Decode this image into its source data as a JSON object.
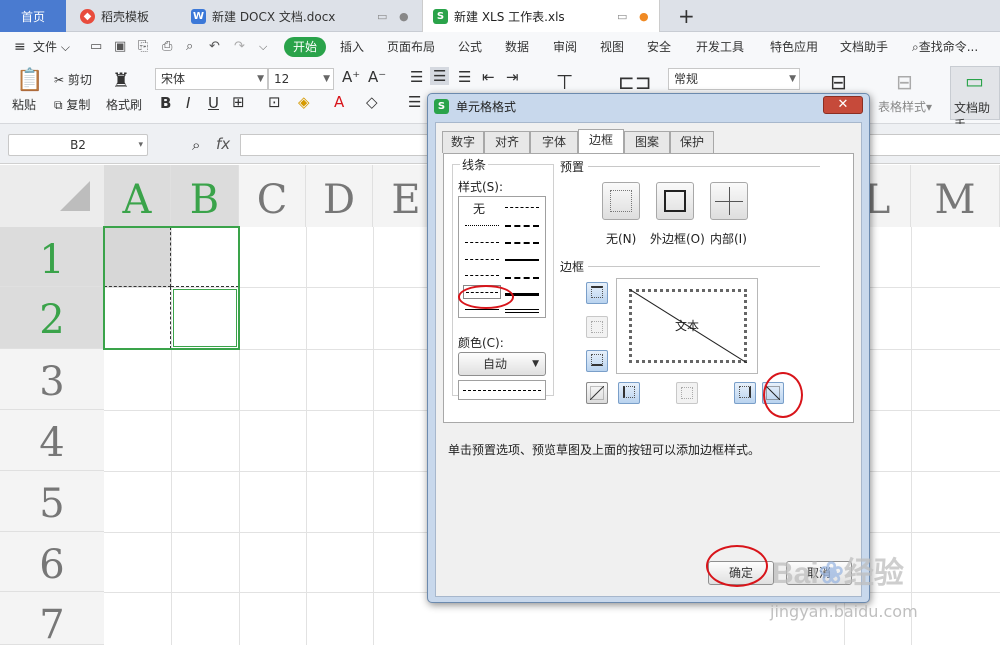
{
  "tabs": {
    "home": "首页",
    "template": "稻壳模板",
    "docx": "新建 DOCX 文档.docx",
    "xls": "新建 XLS 工作表.xls",
    "add": "+"
  },
  "menu": {
    "file": "文件",
    "start": "开始",
    "items": [
      "插入",
      "页面布局",
      "公式",
      "数据",
      "审阅",
      "视图",
      "安全",
      "开发工具",
      "特色应用",
      "文档助手"
    ],
    "search": "查找命令..."
  },
  "ribbon": {
    "paste": "粘贴",
    "cut": "剪切",
    "copy": "复制",
    "format_painter": "格式刷",
    "font": "宋体",
    "size": "12",
    "bold": "B",
    "italic": "I",
    "underline": "U",
    "number_format": "常规",
    "table_style": "表格样式",
    "doc_helper": "文档助手"
  },
  "formula": {
    "cell_ref": "B2",
    "fx": "fx"
  },
  "grid": {
    "columns": [
      "A",
      "B",
      "C",
      "D",
      "E",
      "L",
      "M"
    ],
    "rows": [
      "1",
      "2",
      "3",
      "4",
      "5",
      "6",
      "7"
    ]
  },
  "dialog": {
    "title": "单元格格式",
    "close": "✕",
    "tabs": [
      "数字",
      "对齐",
      "字体",
      "边框",
      "图案",
      "保护"
    ],
    "line_group": "线条",
    "style_label": "样式(S):",
    "style_none": "无",
    "color_label": "颜色(C):",
    "color_value": "自动",
    "preset_label": "预置",
    "preset_none": "无(N)",
    "preset_outline": "外边框(O)",
    "preset_inside": "内部(I)",
    "border_label": "边框",
    "preview_text": "文本",
    "hint": "单击预置选项、预览草图及上面的按钮可以添加边框样式。",
    "ok": "确定",
    "cancel": "取消"
  },
  "watermark": {
    "brand": "Bai",
    "brand2": "经验",
    "url": "jingyan.baidu.com"
  }
}
